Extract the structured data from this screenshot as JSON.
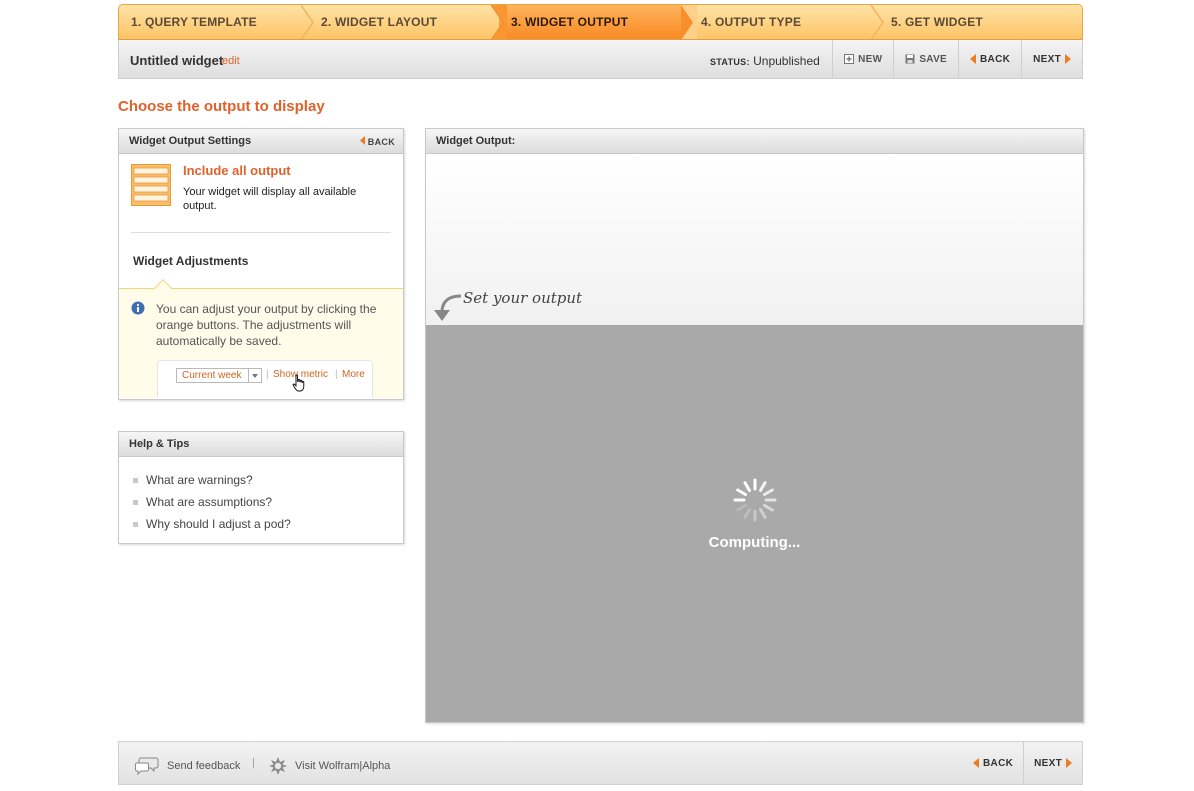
{
  "steps": [
    {
      "label": "1. QUERY TEMPLATE",
      "active": false
    },
    {
      "label": "2. WIDGET LAYOUT",
      "active": false
    },
    {
      "label": "3. WIDGET OUTPUT",
      "active": true
    },
    {
      "label": "4. OUTPUT TYPE",
      "active": false
    },
    {
      "label": "5. GET WIDGET",
      "active": false
    }
  ],
  "titlebar": {
    "widget_name": "Untitled widget",
    "edit_label": "edit",
    "status_label": "STATUS:",
    "status_value": "Unpublished",
    "new_label": "NEW",
    "save_label": "SAVE",
    "back_label": "BACK",
    "next_label": "NEXT"
  },
  "heading": "Choose the output to display",
  "settings": {
    "title": "Widget Output Settings",
    "back_label": "BACK",
    "include_title": "Include all output",
    "include_desc": "Your widget will display all available output.",
    "adjust_title": "Widget Adjustments",
    "adjust_text": "You can adjust your output by clicking the orange buttons. The adjustments will automatically be saved.",
    "demo_select": "Current week",
    "demo_link_1": "Show metric",
    "demo_link_2": "More",
    "demo_pipe": "|"
  },
  "help": {
    "title": "Help & Tips",
    "items": [
      "What are warnings?",
      "What are assumptions?",
      "Why should I adjust a pod?"
    ]
  },
  "output": {
    "title": "Widget Output:",
    "hint": "Set your output",
    "computing": "Computing..."
  },
  "footer": {
    "feedback": "Send feedback",
    "pipe": "|",
    "visit": "Visit Wolfram|Alpha",
    "back_label": "BACK",
    "next_label": "NEXT"
  },
  "colors": {
    "accent": "#e0622a",
    "step_bg": "#fdc466",
    "step_active": "#f98a25",
    "gray_overlay": "#a9a9a9"
  }
}
